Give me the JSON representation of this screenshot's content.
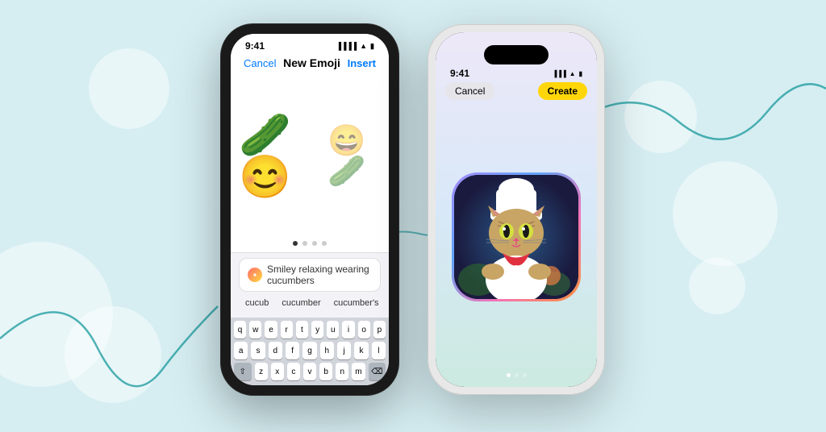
{
  "background": {
    "color": "#d6eef2"
  },
  "phone_left": {
    "status_bar": {
      "time": "9:41",
      "signal": "●●●●",
      "wifi": "WiFi",
      "battery": "Battery"
    },
    "nav": {
      "cancel": "Cancel",
      "title": "New Emoji",
      "insert": "Insert"
    },
    "emojis": [
      "🥒😊",
      "😄"
    ],
    "search_input": "Smiley relaxing wearing cucumbers",
    "autocomplete": [
      "cucub",
      "cucumber",
      "cucumber's"
    ],
    "keyboard_rows": [
      [
        "q",
        "w",
        "e",
        "r",
        "t",
        "y",
        "u",
        "i",
        "o",
        "p"
      ],
      [
        "a",
        "s",
        "d",
        "f",
        "g",
        "h",
        "j",
        "k",
        "l"
      ],
      [
        "z",
        "x",
        "c",
        "v",
        "b",
        "n",
        "m"
      ]
    ]
  },
  "phone_right": {
    "status_bar": {
      "time": "9:41",
      "signal": "●●●",
      "wifi": "WiFi",
      "battery": "Battery"
    },
    "nav": {
      "cancel": "Cancel",
      "create": "Create"
    },
    "image_alt": "AI generated chef cat"
  }
}
